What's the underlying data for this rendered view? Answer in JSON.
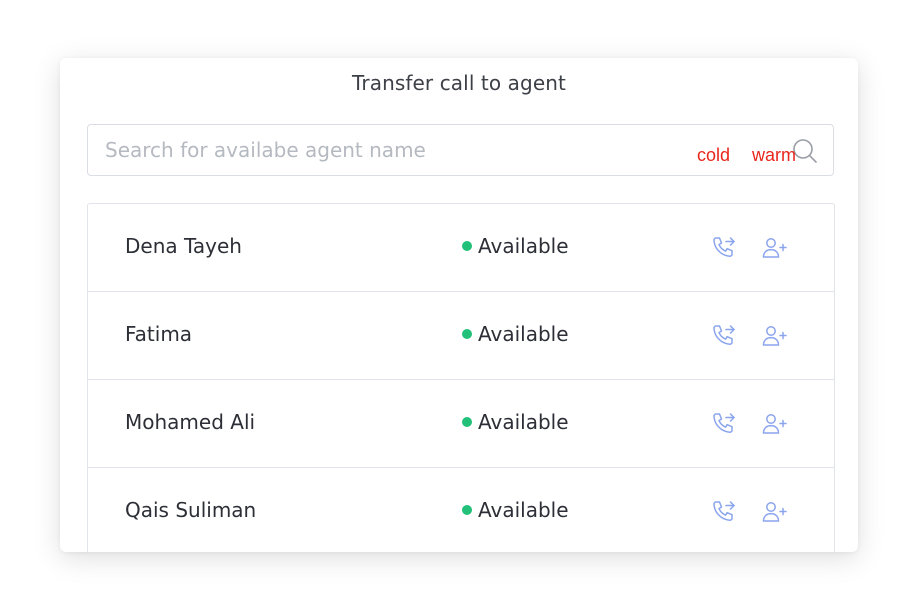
{
  "dialog": {
    "title": "Transfer call to agent"
  },
  "search": {
    "placeholder": "Search for availabe agent name",
    "value": "",
    "icon": "search-icon"
  },
  "annotations": {
    "cold_label": "cold",
    "warm_label": "warm",
    "color": "#e8271c"
  },
  "colors": {
    "available_dot": "#23c07a",
    "action_icon": "#8aa4ee"
  },
  "agents": [
    {
      "name": "Dena Tayeh",
      "status": "Available",
      "cold_icon": "phone-forward-icon",
      "warm_icon": "user-add-icon"
    },
    {
      "name": "Fatima",
      "status": "Available",
      "cold_icon": "phone-forward-icon",
      "warm_icon": "user-add-icon"
    },
    {
      "name": "Mohamed Ali",
      "status": "Available",
      "cold_icon": "phone-forward-icon",
      "warm_icon": "user-add-icon"
    },
    {
      "name": "Qais Suliman",
      "status": "Available",
      "cold_icon": "phone-forward-icon",
      "warm_icon": "user-add-icon"
    }
  ]
}
